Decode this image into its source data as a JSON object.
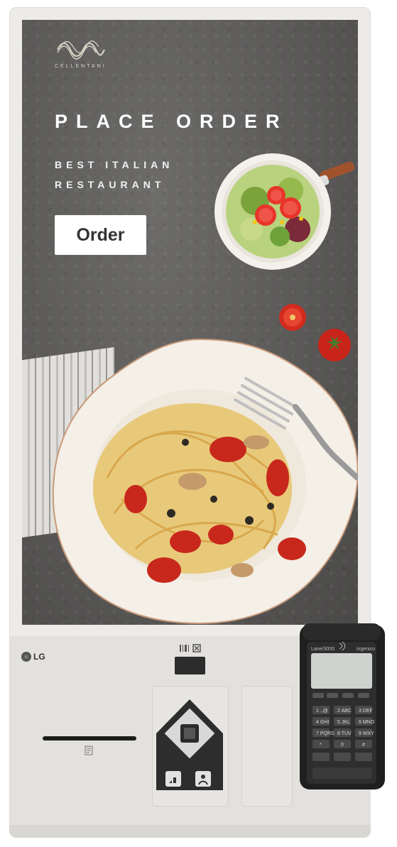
{
  "screen": {
    "brand_name": "CELLENTANI",
    "title": "PLACE ORDER",
    "subtitle": "BEST ITALIAN RESTAURANT",
    "order_button": "Order"
  },
  "hardware": {
    "logo": "LG",
    "terminal_brand_left": "Lane/3000",
    "terminal_brand_right": "ingenico",
    "keypad": [
      [
        "1 .,@",
        "2 ABC",
        "3 DEF"
      ],
      [
        "4 GHI",
        "5 JKL",
        "6 MNO"
      ],
      [
        "7 PQRS",
        "8 TUV",
        "9 WXY"
      ],
      [
        "*",
        "0",
        "#"
      ]
    ]
  },
  "icons": {
    "logo": "cellentani-wave-logo",
    "scanner": "barcode-scanner-icon",
    "receipt": "receipt-icon",
    "nav": "navigation-pad-icon",
    "accessibility": "accessibility-icon",
    "contactless": "contactless-icon"
  }
}
